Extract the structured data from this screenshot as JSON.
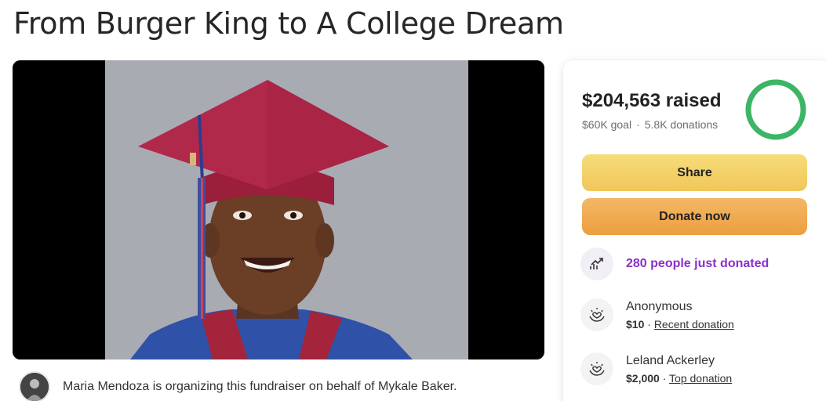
{
  "title": "From Burger King to A College Dream",
  "hero": {
    "image": "graduation-portrait"
  },
  "organizer": {
    "text": "Maria Mendoza is organizing this fundraiser on behalf of Mykale Baker."
  },
  "sidebar": {
    "raised": "$204,563 raised",
    "goal": "$60K goal",
    "separator": "·",
    "donations": "5.8K donations",
    "progress_fraction": 1.0,
    "share_label": "Share",
    "donate_label": "Donate now",
    "trend_text": "280 people just donated",
    "donors": [
      {
        "name": "Anonymous",
        "amount": "$10",
        "sep": " · ",
        "tag": "Recent donation"
      },
      {
        "name": "Leland Ackerley",
        "amount": "$2,000",
        "sep": " · ",
        "tag": "Top donation"
      }
    ]
  },
  "colors": {
    "accent_purple": "#8b2fc9",
    "share_button": "#f2cf66",
    "donate_button": "#eea84c",
    "progress_ring": "#3cb565"
  },
  "icons": [
    "trend-up-icon",
    "heart-hands-icon"
  ]
}
